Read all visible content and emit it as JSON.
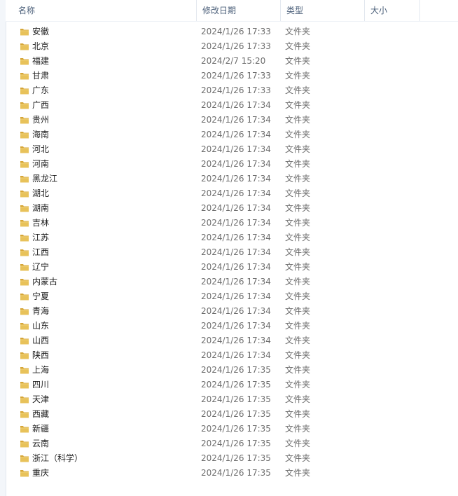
{
  "columns": {
    "name": "名称",
    "modified": "修改日期",
    "type": "类型",
    "size": "大小"
  },
  "sort_indicator": "^",
  "rows": [
    {
      "name": "安徽",
      "date": "2024/1/26 17:33",
      "type": "文件夹",
      "size": ""
    },
    {
      "name": "北京",
      "date": "2024/1/26 17:33",
      "type": "文件夹",
      "size": ""
    },
    {
      "name": "福建",
      "date": "2024/2/7 15:20",
      "type": "文件夹",
      "size": ""
    },
    {
      "name": "甘肃",
      "date": "2024/1/26 17:33",
      "type": "文件夹",
      "size": ""
    },
    {
      "name": "广东",
      "date": "2024/1/26 17:33",
      "type": "文件夹",
      "size": ""
    },
    {
      "name": "广西",
      "date": "2024/1/26 17:34",
      "type": "文件夹",
      "size": ""
    },
    {
      "name": "贵州",
      "date": "2024/1/26 17:34",
      "type": "文件夹",
      "size": ""
    },
    {
      "name": "海南",
      "date": "2024/1/26 17:34",
      "type": "文件夹",
      "size": ""
    },
    {
      "name": "河北",
      "date": "2024/1/26 17:34",
      "type": "文件夹",
      "size": ""
    },
    {
      "name": "河南",
      "date": "2024/1/26 17:34",
      "type": "文件夹",
      "size": ""
    },
    {
      "name": "黑龙江",
      "date": "2024/1/26 17:34",
      "type": "文件夹",
      "size": ""
    },
    {
      "name": "湖北",
      "date": "2024/1/26 17:34",
      "type": "文件夹",
      "size": ""
    },
    {
      "name": "湖南",
      "date": "2024/1/26 17:34",
      "type": "文件夹",
      "size": ""
    },
    {
      "name": "吉林",
      "date": "2024/1/26 17:34",
      "type": "文件夹",
      "size": ""
    },
    {
      "name": "江苏",
      "date": "2024/1/26 17:34",
      "type": "文件夹",
      "size": ""
    },
    {
      "name": "江西",
      "date": "2024/1/26 17:34",
      "type": "文件夹",
      "size": ""
    },
    {
      "name": "辽宁",
      "date": "2024/1/26 17:34",
      "type": "文件夹",
      "size": ""
    },
    {
      "name": "内蒙古",
      "date": "2024/1/26 17:34",
      "type": "文件夹",
      "size": ""
    },
    {
      "name": "宁夏",
      "date": "2024/1/26 17:34",
      "type": "文件夹",
      "size": ""
    },
    {
      "name": "青海",
      "date": "2024/1/26 17:34",
      "type": "文件夹",
      "size": ""
    },
    {
      "name": "山东",
      "date": "2024/1/26 17:34",
      "type": "文件夹",
      "size": ""
    },
    {
      "name": "山西",
      "date": "2024/1/26 17:34",
      "type": "文件夹",
      "size": ""
    },
    {
      "name": "陕西",
      "date": "2024/1/26 17:34",
      "type": "文件夹",
      "size": ""
    },
    {
      "name": "上海",
      "date": "2024/1/26 17:35",
      "type": "文件夹",
      "size": ""
    },
    {
      "name": "四川",
      "date": "2024/1/26 17:35",
      "type": "文件夹",
      "size": ""
    },
    {
      "name": "天津",
      "date": "2024/1/26 17:35",
      "type": "文件夹",
      "size": ""
    },
    {
      "name": "西藏",
      "date": "2024/1/26 17:35",
      "type": "文件夹",
      "size": ""
    },
    {
      "name": "新疆",
      "date": "2024/1/26 17:35",
      "type": "文件夹",
      "size": ""
    },
    {
      "name": "云南",
      "date": "2024/1/26 17:35",
      "type": "文件夹",
      "size": ""
    },
    {
      "name": "浙江（科学）",
      "date": "2024/1/26 17:35",
      "type": "文件夹",
      "size": ""
    },
    {
      "name": "重庆",
      "date": "2024/1/26 17:35",
      "type": "文件夹",
      "size": ""
    }
  ],
  "icons": {
    "row_icon": "folder-icon"
  },
  "colors": {
    "folder_fill": "#e8c25a",
    "folder_tab": "#d6a637",
    "header_text": "#4c607a",
    "secondary_text": "#6d6d6d"
  }
}
